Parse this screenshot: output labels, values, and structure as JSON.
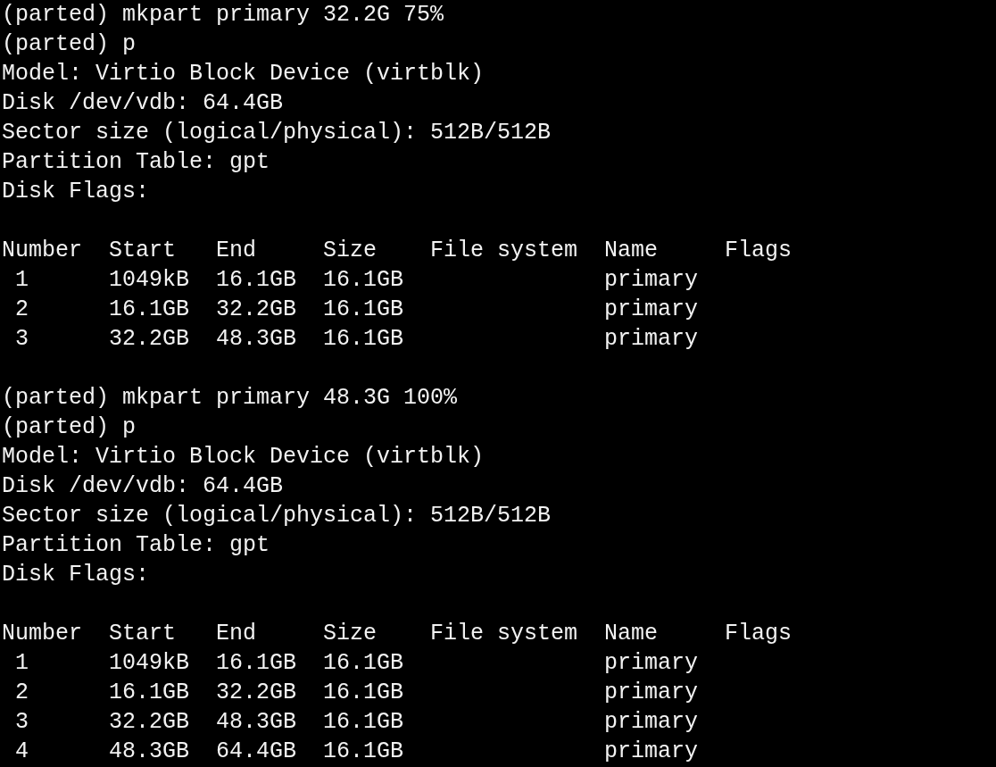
{
  "sessions": [
    {
      "command": "(parted) mkpart primary 32.2G 75%",
      "print_command": "(parted) p",
      "info": [
        "Model: Virtio Block Device (virtblk)",
        "Disk /dev/vdb: 64.4GB",
        "Sector size (logical/physical): 512B/512B",
        "Partition Table: gpt",
        "Disk Flags:"
      ],
      "table": {
        "columns": [
          "Number",
          "Start",
          "End",
          "Size",
          "File system",
          "Name",
          "Flags"
        ],
        "rows": [
          [
            "1",
            "1049kB",
            "16.1GB",
            "16.1GB",
            "",
            "primary",
            ""
          ],
          [
            "2",
            "16.1GB",
            "32.2GB",
            "16.1GB",
            "",
            "primary",
            ""
          ],
          [
            "3",
            "32.2GB",
            "48.3GB",
            "16.1GB",
            "",
            "primary",
            ""
          ]
        ]
      }
    },
    {
      "command": "(parted) mkpart primary 48.3G 100%",
      "print_command": "(parted) p",
      "info": [
        "Model: Virtio Block Device (virtblk)",
        "Disk /dev/vdb: 64.4GB",
        "Sector size (logical/physical): 512B/512B",
        "Partition Table: gpt",
        "Disk Flags:"
      ],
      "table": {
        "columns": [
          "Number",
          "Start",
          "End",
          "Size",
          "File system",
          "Name",
          "Flags"
        ],
        "rows": [
          [
            "1",
            "1049kB",
            "16.1GB",
            "16.1GB",
            "",
            "primary",
            ""
          ],
          [
            "2",
            "16.1GB",
            "32.2GB",
            "16.1GB",
            "",
            "primary",
            ""
          ],
          [
            "3",
            "32.2GB",
            "48.3GB",
            "16.1GB",
            "",
            "primary",
            ""
          ],
          [
            "4",
            "48.3GB",
            "64.4GB",
            "16.1GB",
            "",
            "primary",
            ""
          ]
        ]
      }
    }
  ]
}
